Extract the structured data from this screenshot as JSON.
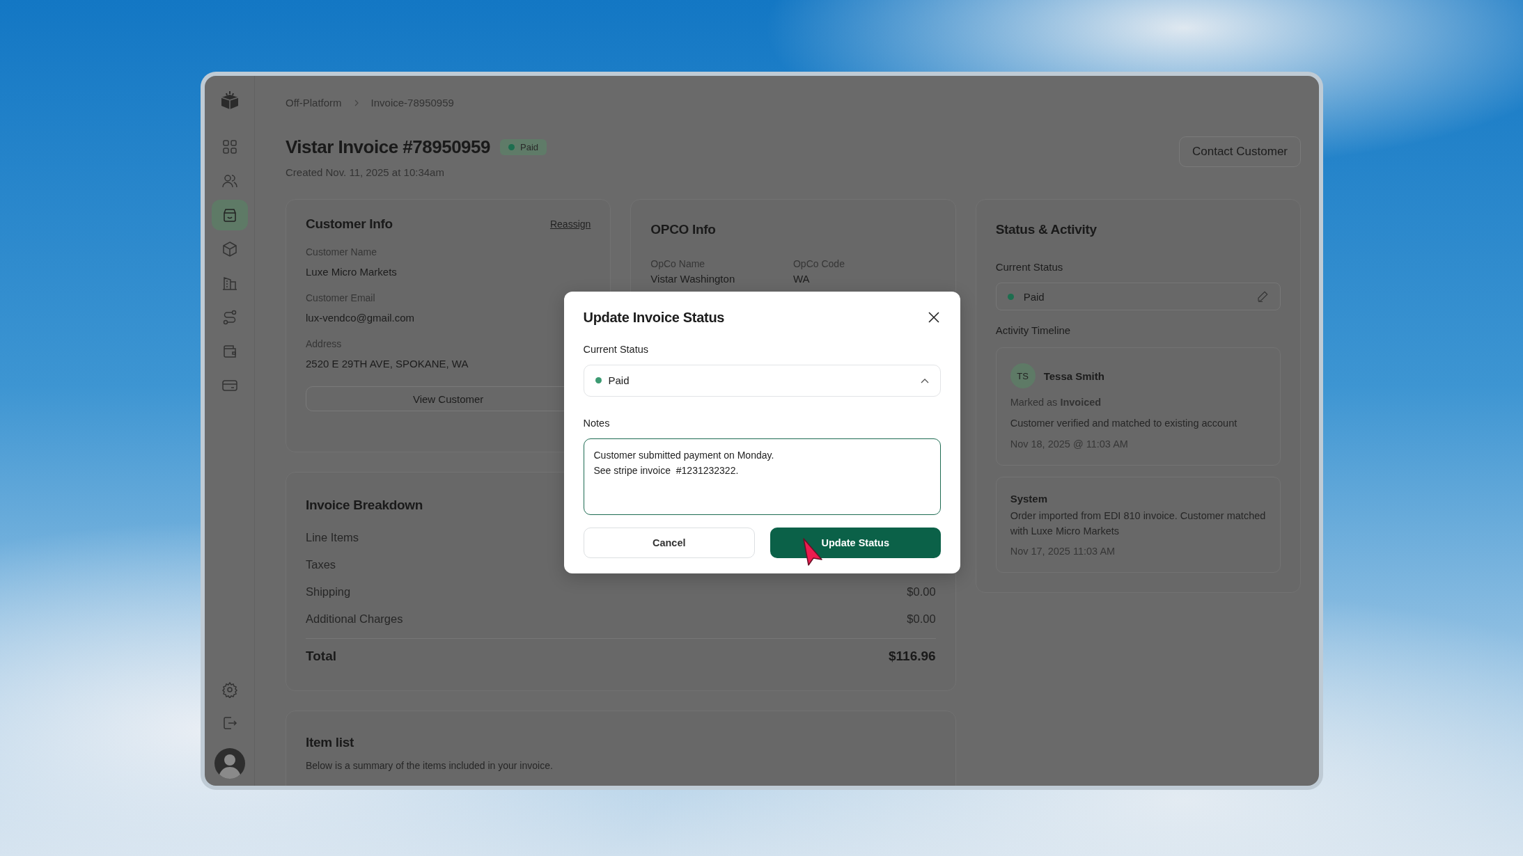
{
  "sidebar": {
    "items": [
      {
        "selected": false
      },
      {
        "selected": false
      },
      {
        "selected": true
      },
      {
        "selected": false
      },
      {
        "selected": false
      },
      {
        "selected": false
      },
      {
        "selected": false
      },
      {
        "selected": false
      }
    ]
  },
  "breadcrumb": [
    "Off-Platform",
    "Invoice-78950959"
  ],
  "header": {
    "title": "Vistar Invoice #78950959",
    "badge": {
      "label": "Paid",
      "color": "#1d6e4f"
    },
    "created": "Created Nov. 11, 2025 at 10:34am",
    "contact_button": "Contact Customer"
  },
  "customer_info": {
    "title": "Customer Info",
    "action": "Reassign",
    "fields": [
      {
        "label": "Customer Name",
        "value": "Luxe Micro Markets"
      },
      {
        "label": "Customer Email",
        "value": "lux-vendco@gmail.com"
      },
      {
        "label": "Address",
        "value": "2520 E 29TH AVE, SPOKANE, WA"
      }
    ],
    "button": "View Customer"
  },
  "opco_info": {
    "title": "OPCO Info",
    "fields": [
      {
        "label": "OpCo Name",
        "value": "Vistar Washington"
      },
      {
        "label": "OpCo Code",
        "value": "WA"
      }
    ]
  },
  "invoice_breakdown": {
    "title": "Invoice Breakdown",
    "rows": [
      {
        "label": "Line Items"
      },
      {
        "label": "Taxes"
      },
      {
        "label": "Shipping",
        "value": "$0.00"
      },
      {
        "label": "Additional Charges",
        "value": "$0.00"
      }
    ],
    "total": {
      "label": "Total",
      "value": "$116.96"
    }
  },
  "item_list": {
    "title": "Item list",
    "description": "Below is a summary of the items included in your invoice."
  },
  "status_activity": {
    "title": "Status & Activity",
    "current_status_label": "Current Status",
    "current_status": {
      "label": "Paid",
      "color": "#1d6e4f"
    },
    "timeline_label": "Activity Timeline",
    "entries": [
      {
        "kind": "user",
        "initials": "TS",
        "author": "Tessa Smith",
        "action": "Marked as **Invoiced**",
        "note": "Customer verified and matched to existing account",
        "time": "Nov 18, 2025 @ 11:03 AM"
      },
      {
        "kind": "system",
        "author": "System",
        "note": "Order imported from EDI 810 invoice. Customer matched with Luxe Micro Markets",
        "time": "Nov 17, 2025 11:03 AM"
      }
    ]
  },
  "modal": {
    "title": "Update Invoice Status",
    "status_label": "Current Status",
    "status": {
      "label": "Paid",
      "color": "#3c9a72"
    },
    "notes_label": "Notes",
    "notes_value": "Customer submitted payment on Monday.\nSee stripe invoice  #1231232322.",
    "cancel": "Cancel",
    "submit": "Update Status"
  }
}
